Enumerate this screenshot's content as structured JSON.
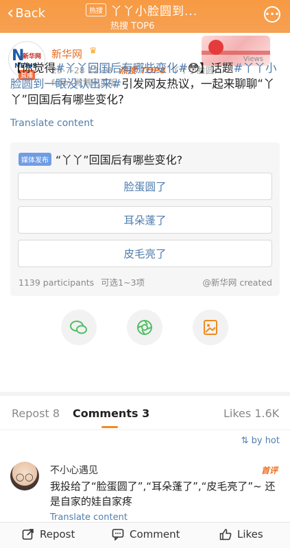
{
  "header": {
    "back_label": "Back",
    "hot_pill": "热搜",
    "title": "丫丫小脸圆到...",
    "subtitle": "热搜 TOP6",
    "more_icon": "more-icon"
  },
  "post": {
    "author": "新华网",
    "avatar_badge": "直播",
    "timestamp": "23-7-28 12:18",
    "hot_label": "热搜",
    "top_label": "TOP8",
    "topic_snippet": "丫丫小脸圆...",
    "source": "from 微博网页版",
    "banner_views": "Views",
    "text_prefix": "【你觉得",
    "tag1": "#丫丫回国后有哪些变化#",
    "text_mid": "😳】话题",
    "tag2": "#丫丫小脸圆到一眼没认出来#",
    "text_suffix": "引发网友热议，一起来聊聊“丫丫”回国后有哪些变化?",
    "translate": "Translate content"
  },
  "poll": {
    "badge": "媒体发布",
    "question": "“丫丫”回国后有哪些变化?",
    "options": [
      "脸蛋圆了",
      "耳朵蓬了",
      "皮毛亮了"
    ],
    "participants": "1139 participants",
    "choose": "可选1~3项",
    "creator": "@新华网 created"
  },
  "tabs": {
    "repost": "Repost 8",
    "comments": "Comments 3",
    "likes": "Likes 1.6K",
    "sort": "⇅ by hot"
  },
  "comment": {
    "name": "不小心遇见",
    "first_badge": "首评",
    "text": "我投给了“脸蛋圆了”,“耳朵蓬了”,“皮毛亮了”~ 还是自家的娃自家疼",
    "translate": "Translate content"
  },
  "bottom": {
    "repost": "Repost",
    "comment": "Comment",
    "likes": "Likes"
  },
  "colors": {
    "header": "#f79a43",
    "link": "#507daf",
    "accent": "#f26b1d"
  }
}
